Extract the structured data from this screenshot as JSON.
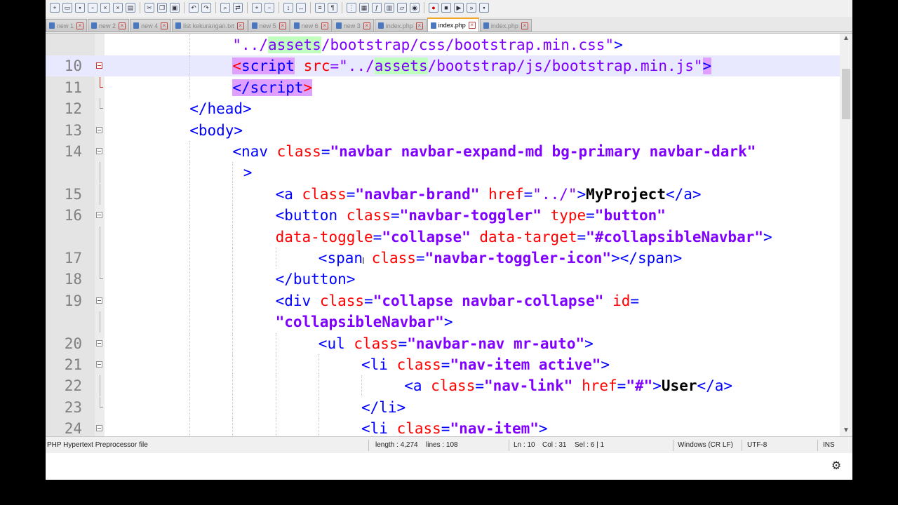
{
  "tabs": [
    {
      "label": "new 1",
      "active": false
    },
    {
      "label": "new 2",
      "active": false
    },
    {
      "label": "new 4",
      "active": false
    },
    {
      "label": "list kekurangan.txt",
      "active": false
    },
    {
      "label": "new 5",
      "active": false
    },
    {
      "label": "new 6",
      "active": false
    },
    {
      "label": "new 3",
      "active": false
    },
    {
      "label": "index.php",
      "active": false
    },
    {
      "label": "index.php",
      "active": true
    },
    {
      "label": "index.php",
      "active": false
    }
  ],
  "editor": {
    "lines": [
      {
        "num": "",
        "fold": "none",
        "indent": 8,
        "tokens": [
          {
            "t": "\"../",
            "c": "strn"
          },
          {
            "t": "assets",
            "c": "strn sel"
          },
          {
            "t": "/bootstrap/css/bootstrap.min.css",
            "c": "strn"
          },
          {
            "t": "\"",
            "c": "strn"
          },
          {
            "t": ">",
            "c": "tag"
          }
        ]
      },
      {
        "num": "10",
        "fold": "box-red",
        "indent": 8,
        "highlight": true,
        "tokens": [
          {
            "t": "<",
            "c": "tag tagm attr"
          },
          {
            "t": "script",
            "c": "tag tagm"
          },
          {
            "t": " ",
            "c": ""
          },
          {
            "t": "src",
            "c": "attr"
          },
          {
            "t": "=",
            "c": "strn"
          },
          {
            "t": "\"../",
            "c": "strn"
          },
          {
            "t": "assets",
            "c": "strn sel"
          },
          {
            "t": "/bootstrap/js/bootstrap.min.js\"",
            "c": "strn"
          },
          {
            "t": ">",
            "c": "tag tagm"
          }
        ]
      },
      {
        "num": "11",
        "fold": "end-red",
        "indent": 8,
        "tokens": [
          {
            "t": "</script",
            "c": "tag tagm"
          },
          {
            "t": ">",
            "c": "tag tagm attr"
          }
        ]
      },
      {
        "num": "12",
        "fold": "end",
        "indent": 4,
        "tokens": [
          {
            "t": "</head>",
            "c": "tag"
          }
        ]
      },
      {
        "num": "13",
        "fold": "box",
        "indent": 4,
        "tokens": [
          {
            "t": "<body>",
            "c": "tag"
          }
        ]
      },
      {
        "num": "14",
        "fold": "box",
        "indent": 8,
        "tokens": [
          {
            "t": "<nav ",
            "c": "tag"
          },
          {
            "t": "class",
            "c": "attr"
          },
          {
            "t": "=",
            "c": "tag"
          },
          {
            "t": "\"navbar navbar-expand-md bg-primary navbar-dark\"",
            "c": "str"
          }
        ]
      },
      {
        "num": "",
        "fold": "line",
        "indent": 9,
        "tokens": [
          {
            "t": ">",
            "c": "tag"
          }
        ]
      },
      {
        "num": "15",
        "fold": "line",
        "indent": 12,
        "tokens": [
          {
            "t": "<a ",
            "c": "tag"
          },
          {
            "t": "class",
            "c": "attr"
          },
          {
            "t": "=",
            "c": "tag"
          },
          {
            "t": "\"navbar-brand\"",
            "c": "str"
          },
          {
            "t": " href",
            "c": "attr"
          },
          {
            "t": "=",
            "c": "tag"
          },
          {
            "t": "\"../\"",
            "c": "strn"
          },
          {
            "t": ">",
            "c": "tag"
          },
          {
            "t": "MyProject",
            "c": "txtc"
          },
          {
            "t": "</a>",
            "c": "tag"
          }
        ]
      },
      {
        "num": "16",
        "fold": "box",
        "indent": 12,
        "tokens": [
          {
            "t": "<button ",
            "c": "tag"
          },
          {
            "t": "class",
            "c": "attr"
          },
          {
            "t": "=",
            "c": "tag"
          },
          {
            "t": "\"navbar-toggler\"",
            "c": "str"
          },
          {
            "t": " type",
            "c": "attr"
          },
          {
            "t": "=",
            "c": "tag"
          },
          {
            "t": "\"button\"",
            "c": "str"
          }
        ]
      },
      {
        "num": "",
        "fold": "line",
        "indent": 12,
        "tokens": [
          {
            "t": "data-toggle",
            "c": "attr"
          },
          {
            "t": "=",
            "c": "tag"
          },
          {
            "t": "\"collapse\"",
            "c": "str"
          },
          {
            "t": " data-target",
            "c": "attr"
          },
          {
            "t": "=",
            "c": "tag"
          },
          {
            "t": "\"#collapsibleNavbar\"",
            "c": "str"
          },
          {
            "t": ">",
            "c": "tag"
          }
        ]
      },
      {
        "num": "17",
        "fold": "line",
        "indent": 16,
        "tokens": [
          {
            "t": "<span ",
            "c": "tag"
          },
          {
            "t": "class",
            "c": "attr"
          },
          {
            "t": "=",
            "c": "tag"
          },
          {
            "t": "\"navbar-toggler-icon\"",
            "c": "str"
          },
          {
            "t": "></span>",
            "c": "tag"
          }
        ]
      },
      {
        "num": "18",
        "fold": "end",
        "indent": 12,
        "tokens": [
          {
            "t": "</button>",
            "c": "tag"
          }
        ]
      },
      {
        "num": "19",
        "fold": "box",
        "indent": 12,
        "tokens": [
          {
            "t": "<div ",
            "c": "tag"
          },
          {
            "t": "class",
            "c": "attr"
          },
          {
            "t": "=",
            "c": "tag"
          },
          {
            "t": "\"collapse navbar-collapse\"",
            "c": "str"
          },
          {
            "t": " id",
            "c": "attr"
          },
          {
            "t": "=",
            "c": "tag"
          }
        ]
      },
      {
        "num": "",
        "fold": "line",
        "indent": 12,
        "tokens": [
          {
            "t": "\"collapsibleNavbar\"",
            "c": "str"
          },
          {
            "t": ">",
            "c": "tag"
          }
        ]
      },
      {
        "num": "20",
        "fold": "box",
        "indent": 16,
        "tokens": [
          {
            "t": "<ul ",
            "c": "tag"
          },
          {
            "t": "class",
            "c": "attr"
          },
          {
            "t": "=",
            "c": "tag"
          },
          {
            "t": "\"navbar-nav mr-auto\"",
            "c": "str"
          },
          {
            "t": ">",
            "c": "tag"
          }
        ]
      },
      {
        "num": "21",
        "fold": "box",
        "indent": 20,
        "tokens": [
          {
            "t": "<li ",
            "c": "tag"
          },
          {
            "t": "class",
            "c": "attr"
          },
          {
            "t": "=",
            "c": "tag"
          },
          {
            "t": "\"nav-item active\"",
            "c": "str"
          },
          {
            "t": ">",
            "c": "tag"
          }
        ]
      },
      {
        "num": "22",
        "fold": "line",
        "indent": 24,
        "tokens": [
          {
            "t": "<a ",
            "c": "tag"
          },
          {
            "t": "class",
            "c": "attr"
          },
          {
            "t": "=",
            "c": "tag"
          },
          {
            "t": "\"nav-link\"",
            "c": "str"
          },
          {
            "t": " href",
            "c": "attr"
          },
          {
            "t": "=",
            "c": "tag"
          },
          {
            "t": "\"#\"",
            "c": "str"
          },
          {
            "t": ">",
            "c": "tag"
          },
          {
            "t": "User",
            "c": "txtc"
          },
          {
            "t": "</a>",
            "c": "tag"
          }
        ]
      },
      {
        "num": "23",
        "fold": "end",
        "indent": 20,
        "tokens": [
          {
            "t": "</li>",
            "c": "tag"
          }
        ]
      },
      {
        "num": "24",
        "fold": "box",
        "indent": 20,
        "tokens": [
          {
            "t": "<li ",
            "c": "tag"
          },
          {
            "t": "class",
            "c": "attr"
          },
          {
            "t": "=",
            "c": "tag"
          },
          {
            "t": "\"nav-item\"",
            "c": "str"
          },
          {
            "t": ">",
            "c": "tag"
          }
        ]
      }
    ]
  },
  "status": {
    "file_type": "PHP Hypertext Preprocessor file",
    "length": "length : 4,274",
    "lines": "lines : 108",
    "ln": "Ln : 10",
    "col": "Col : 31",
    "sel": "Sel : 6 | 1",
    "eol": "Windows (CR LF)",
    "encoding": "UTF-8",
    "mode": "INS"
  },
  "icons": {
    "settings": "gear-icon",
    "scroll_up": "chevron-up-icon",
    "scroll_down": "chevron-down-icon",
    "tab_close": "close-icon"
  },
  "colors": {
    "tag": "#0000ff",
    "attribute": "#ff0000",
    "string": "#8000ff",
    "current_line": "#e8e8ff",
    "match_highlight": "#c0ffc0",
    "tag_match": "#e0a0ff"
  }
}
